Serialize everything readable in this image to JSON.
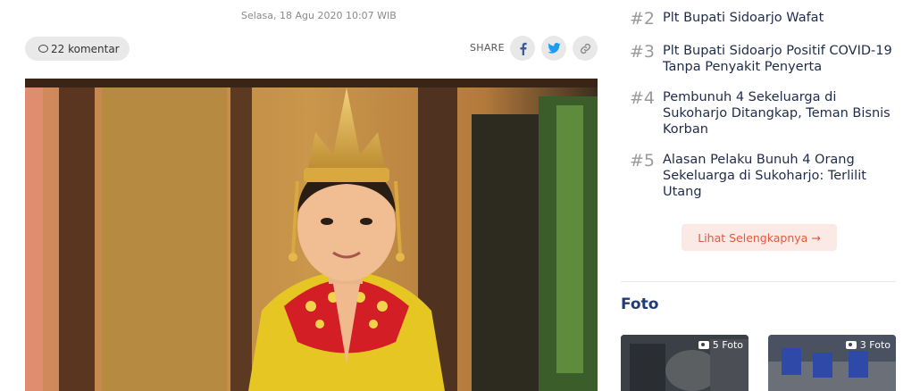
{
  "article": {
    "date": "Selasa, 18 Agu 2020 10:07 WIB",
    "comments_label": "22 komentar",
    "share_label": "SHARE",
    "share_icons": [
      "facebook-icon",
      "twitter-icon",
      "link-icon"
    ]
  },
  "trending": [
    {
      "rank": "#2",
      "title": "Plt Bupati Sidoarjo Wafat"
    },
    {
      "rank": "#3",
      "title": "Plt Bupati Sidoarjo Positif COVID-19 Tanpa Penyakit Penyerta"
    },
    {
      "rank": "#4",
      "title": "Pembunuh 4 Sekeluarga di Sukoharjo Ditangkap, Teman Bisnis Korban"
    },
    {
      "rank": "#5",
      "title": "Alasan Pelaku Bunuh 4 Orang Sekeluarga di Sukoharjo: Terlilit Utang"
    }
  ],
  "more_label": "Lihat Selengkapnya →",
  "foto": {
    "heading": "Foto",
    "items": [
      {
        "count": "5 Foto"
      },
      {
        "count": "3 Foto"
      }
    ]
  },
  "colors": {
    "accent": "#e0593e",
    "heading_blue": "#1f3c78",
    "title_navy": "#1f2b4a"
  }
}
